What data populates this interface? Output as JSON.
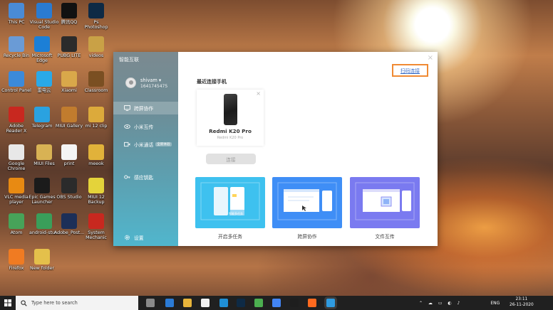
{
  "desktop": {
    "icons": [
      {
        "label": "This PC"
      },
      {
        "label": "Visual Studio Code"
      },
      {
        "label": "腾讯QQ"
      },
      {
        "label": "Ps\nPhotoshop"
      },
      {
        "label": "Recycle Bin"
      },
      {
        "label": "Microsoft Edge"
      },
      {
        "label": "PUBG LITE"
      },
      {
        "label": "videos"
      },
      {
        "label": "Control Panel"
      },
      {
        "label": "雷电云"
      },
      {
        "label": "Xiaomi"
      },
      {
        "label": "Classroom"
      },
      {
        "label": "Adobe Reader X"
      },
      {
        "label": "Telegram"
      },
      {
        "label": "MIUI Gallery"
      },
      {
        "label": "mi 12 clip"
      },
      {
        "label": "Google Chrome"
      },
      {
        "label": "MIUI Files"
      },
      {
        "label": "print"
      },
      {
        "label": "meeok"
      },
      {
        "label": "VLC media player"
      },
      {
        "label": "Epic Games Launcher"
      },
      {
        "label": "OBS Studio"
      },
      {
        "label": "MIUI 12 Backup"
      },
      {
        "label": "Atom"
      },
      {
        "label": "android-stu..."
      },
      {
        "label": "Adobe_Post..."
      },
      {
        "label": "System Mechanic"
      },
      {
        "label": "Firefox"
      },
      {
        "label": "New folder"
      }
    ]
  },
  "window": {
    "app_title": "智能互联",
    "close_glyph": "×",
    "user": {
      "name": "shivam ▾",
      "id": "1641745475"
    },
    "sidebar_items": [
      {
        "label": "跨屏协作"
      },
      {
        "label": "小米互传"
      },
      {
        "label": "小米通话",
        "badge": "全新体验"
      },
      {
        "label": "感应钥匙"
      },
      {
        "label": "设置"
      }
    ],
    "pair_link": "扫码连接",
    "recent_title": "最近连接手机",
    "phone": {
      "name": "Redmi K20 Pro",
      "subtitle": "Redmi K20 Pro",
      "remove_glyph": "×"
    },
    "connect_button": "连接",
    "features": [
      {
        "label": "开启多任务",
        "color": "#3ec1ef",
        "screen_tag": "智能多任务"
      },
      {
        "label": "跨屏协作",
        "color": "#3f8ef6"
      },
      {
        "label": "文件互传",
        "color": "#7a7af0"
      }
    ]
  },
  "taskbar": {
    "search_placeholder": "Type here to search",
    "tray": {
      "language": "ENG",
      "time": "23:11",
      "date": "26-11-2020"
    }
  }
}
